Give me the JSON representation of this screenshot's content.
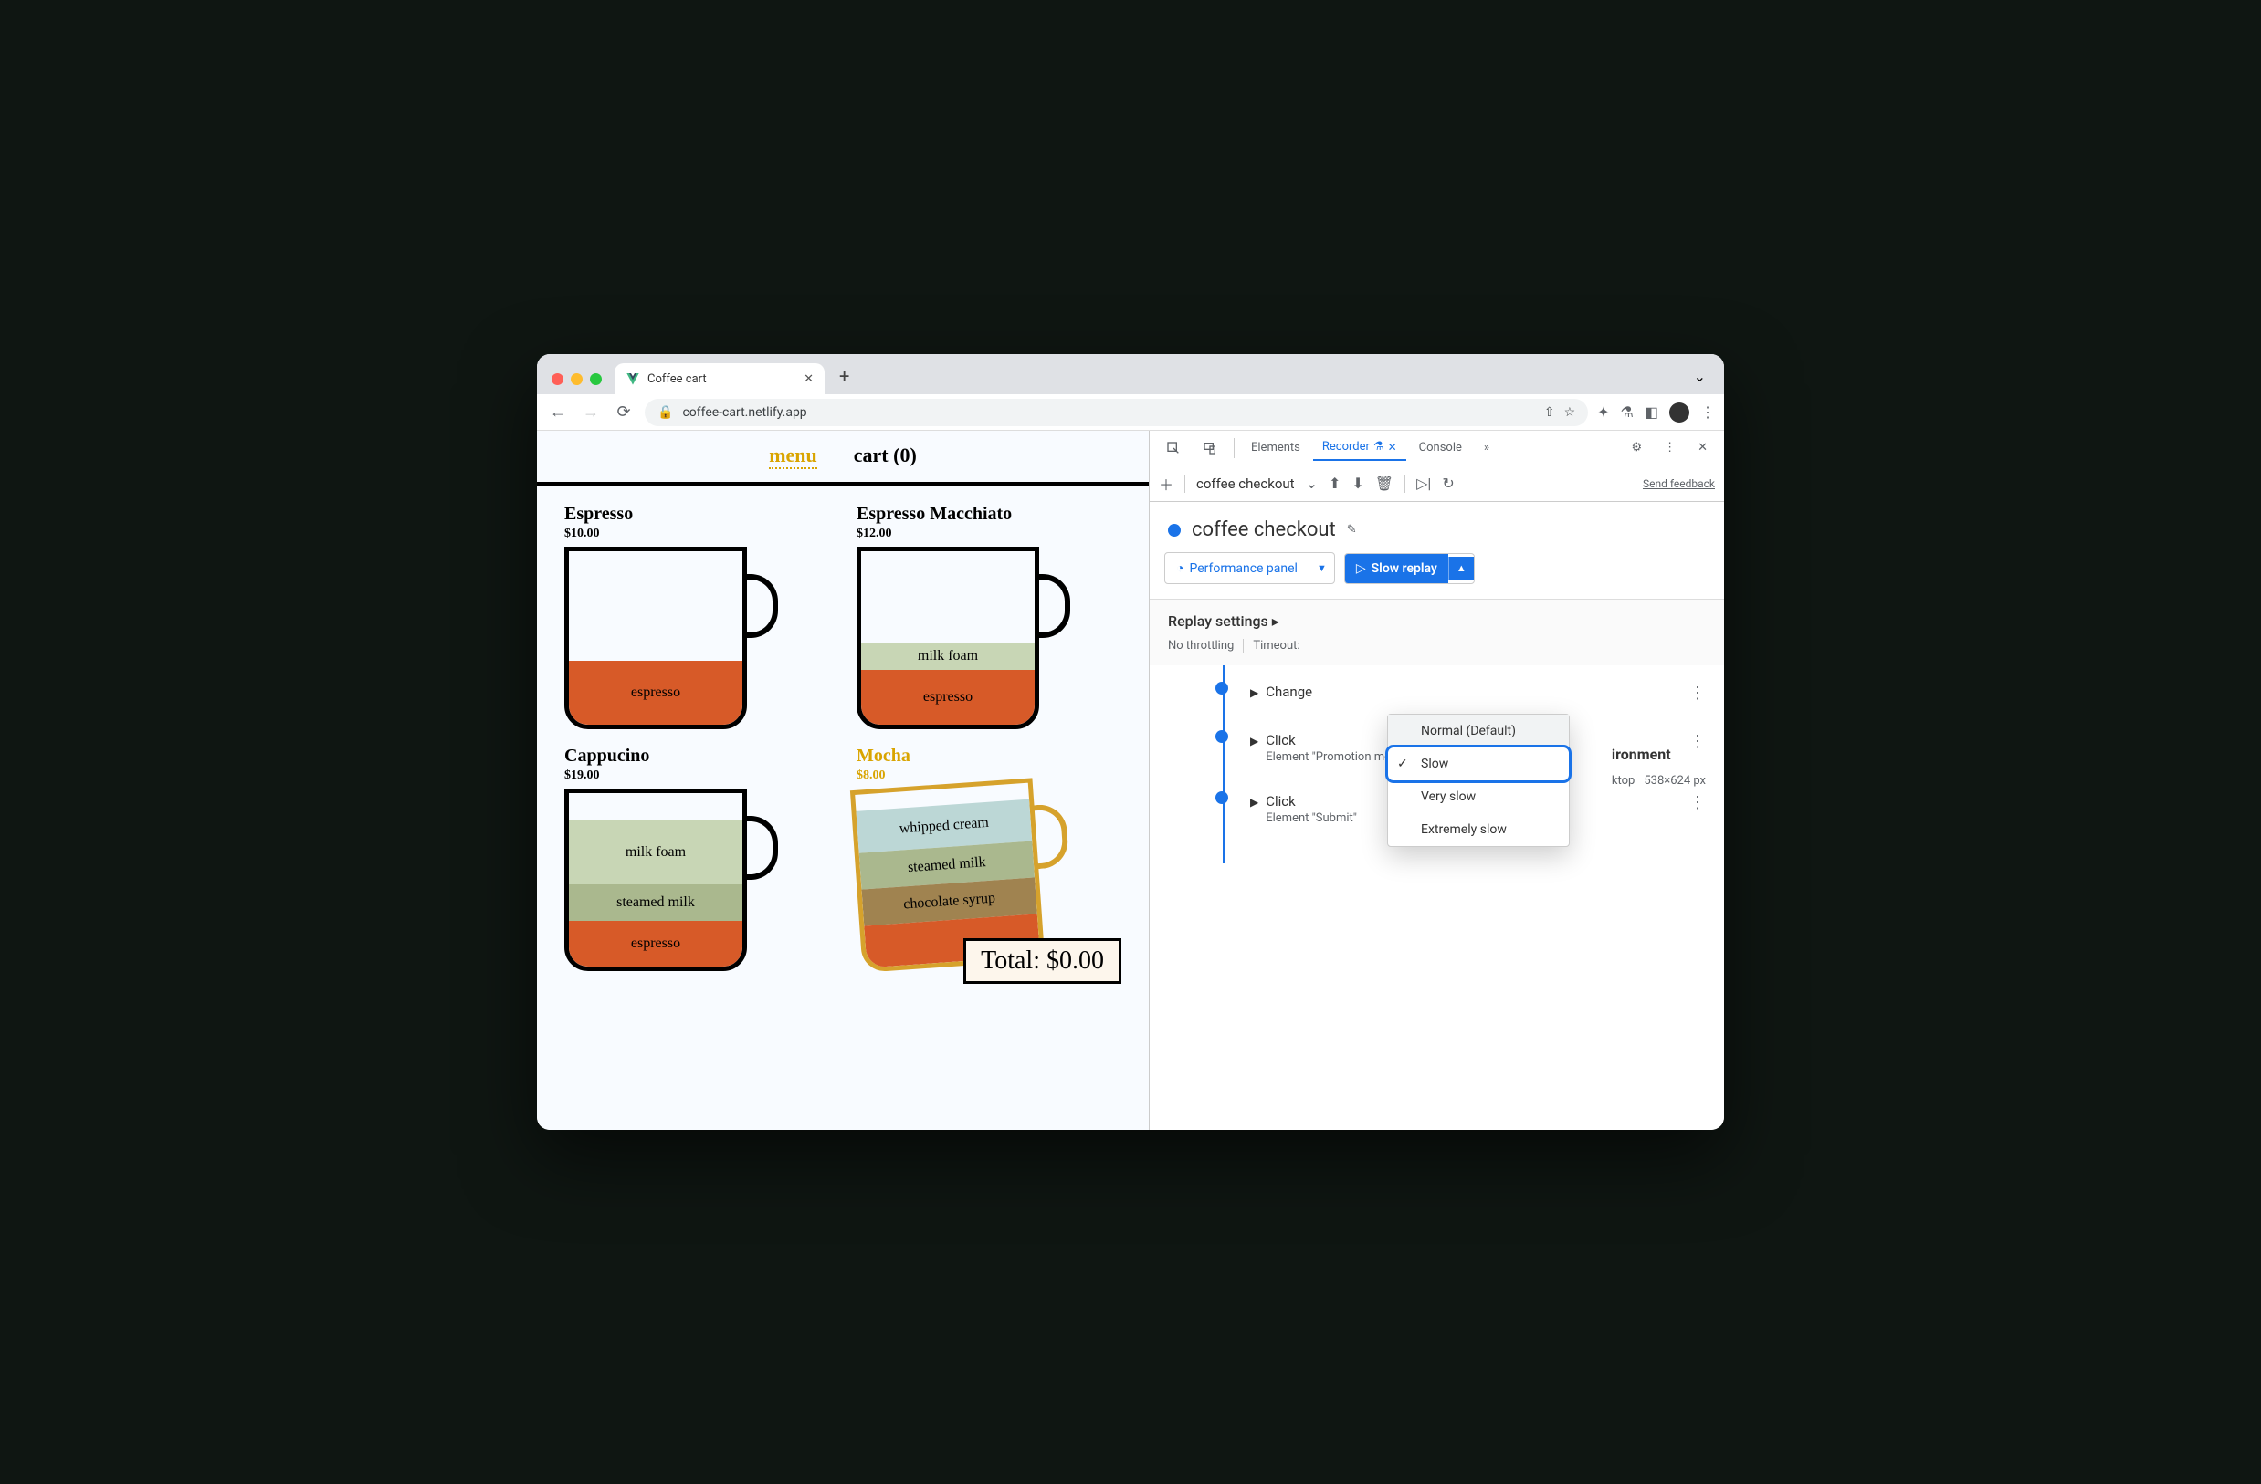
{
  "browser": {
    "tab_title": "Coffee cart",
    "url": "coffee-cart.netlify.app"
  },
  "page": {
    "nav": {
      "menu": "menu",
      "cart": "cart (0)"
    },
    "products": [
      {
        "name": "Espresso",
        "price": "$10.00",
        "layers": [
          {
            "label": "espresso",
            "color": "#d75a28",
            "h": 70
          }
        ]
      },
      {
        "name": "Espresso Macchiato",
        "price": "$12.00",
        "layers": [
          {
            "label": "espresso",
            "color": "#d75a28",
            "h": 60
          },
          {
            "label": "milk foam",
            "color": "#c8d6b5",
            "h": 30
          }
        ]
      },
      {
        "name": "Cappucino",
        "price": "$19.00",
        "layers": [
          {
            "label": "espresso",
            "color": "#d75a28",
            "h": 50
          },
          {
            "label": "steamed milk",
            "color": "#aab88e",
            "h": 40
          },
          {
            "label": "milk foam",
            "color": "#c8d6b5",
            "h": 70
          }
        ]
      },
      {
        "name": "Mocha",
        "price": "$8.00",
        "highlight": true,
        "layers": [
          {
            "label": "",
            "color": "#d75a28",
            "h": 46
          },
          {
            "label": "chocolate syrup",
            "color": "#a08350",
            "h": 40
          },
          {
            "label": "steamed milk",
            "color": "#aab88e",
            "h": 40
          },
          {
            "label": "whipped cream",
            "color": "#bcd7d6",
            "h": 46
          }
        ]
      }
    ],
    "total": "Total: $0.00"
  },
  "devtools": {
    "tabs": {
      "elements": "Elements",
      "recorder": "Recorder",
      "console": "Console"
    },
    "recording_select": "coffee checkout",
    "feedback": "Send feedback",
    "title": "coffee checkout",
    "perf_btn": "Performance panel",
    "replay_btn": "Slow replay",
    "replay_menu": {
      "normal": "Normal (Default)",
      "slow": "Slow",
      "very": "Very slow",
      "extreme": "Extremely slow"
    },
    "settings": {
      "heading": "Replay settings",
      "throttle": "No throttling",
      "timeout_label": "Timeout:"
    },
    "env": {
      "heading": "ironment",
      "device": "ktop",
      "dims": "538×624 px"
    },
    "steps": [
      {
        "t1": "Change",
        "t2": ""
      },
      {
        "t1": "Click",
        "t2": "Element \"Promotion message\""
      },
      {
        "t1": "Click",
        "t2": "Element \"Submit\""
      }
    ]
  }
}
